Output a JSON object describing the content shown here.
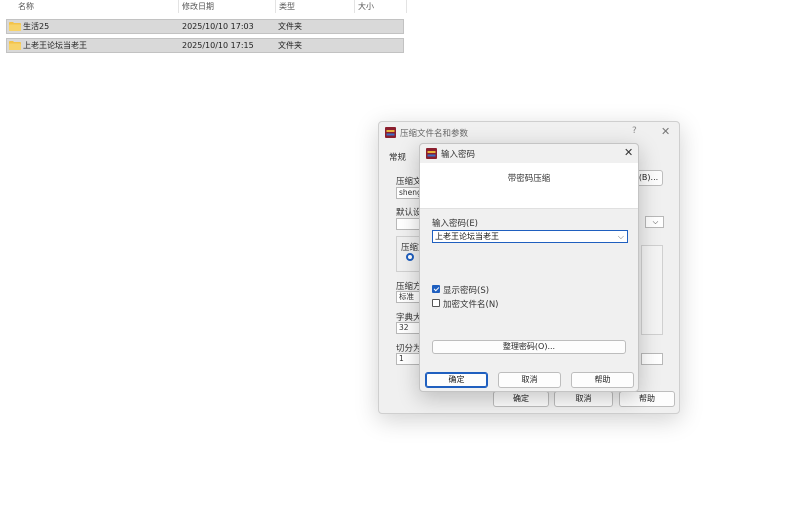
{
  "explorer": {
    "columns": [
      "名称",
      "修改日期",
      "类型",
      "大小"
    ],
    "rows": [
      {
        "name": "生活25",
        "date": "2025/10/10 17:03",
        "type": "文件夹"
      },
      {
        "name": "上老王论坛当老王",
        "date": "2025/10/10 17:15",
        "type": "文件夹"
      }
    ]
  },
  "back_dialog": {
    "title": "压缩文件名和参数",
    "help": "?",
    "tab_general": "常规",
    "archive_name_label": "压缩文",
    "archive_name_value": "shengl",
    "browse_btn": "(B)...",
    "default_config_label": "默认设",
    "format_label": "压缩文",
    "method_label": "压缩方",
    "method_value": "标准",
    "dict_label": "字典大",
    "dict_value": "32",
    "split_label": "切分为",
    "split_value": "1",
    "ok": "确定",
    "cancel": "取消",
    "help_btn": "帮助"
  },
  "pwd_dialog": {
    "title": "输入密码",
    "subtitle": "带密码压缩",
    "input_label": "输入密码(E)",
    "password_value": "上老王论坛当老王",
    "show_password": "显示密码(S)",
    "show_password_checked": true,
    "encrypt_names": "加密文件名(N)",
    "encrypt_names_checked": false,
    "organize_btn": "整理密码(O)...",
    "ok": "确定",
    "cancel": "取消",
    "help_btn": "帮助"
  },
  "colors": {
    "accent": "#1f5fbf",
    "folder": "#f3c34a",
    "selection": "#d9d9d9"
  }
}
